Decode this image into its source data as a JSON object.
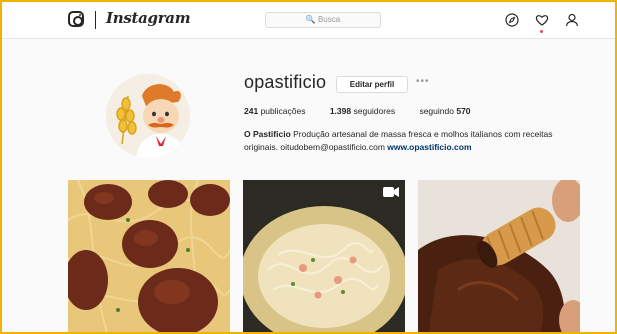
{
  "header": {
    "wordmark": "Instagram",
    "search_placeholder": "🔍 Busca",
    "icons": [
      "instagram-glyph-icon",
      "explore-compass-icon",
      "activity-heart-icon",
      "profile-person-icon"
    ]
  },
  "profile": {
    "username": "opastificio",
    "edit_button": "Editar perfil",
    "more_label": "•••",
    "stats": {
      "posts_count": "241",
      "posts_label": "publicações",
      "followers_count": "1.398",
      "followers_label": "seguidores",
      "following_label": "seguindo",
      "following_count": "570"
    },
    "bio": {
      "name": "O Pastificio",
      "text_line1": "Produção artesanal de massa fresca e molhos italianos com receitas",
      "text_line2": "originais. oitudobem@opastificio.com",
      "link": "www.opastificio.com"
    }
  },
  "grid": {
    "posts": [
      {
        "subject": "meatballs-pasta-photo"
      },
      {
        "subject": "creamy-pasta-bowl-photo",
        "badge": "video-camera-icon"
      },
      {
        "subject": "cannoli-chocolate-photo"
      }
    ]
  },
  "colors": {
    "frame_border": "#f0b400",
    "link": "#003569",
    "notification_dot": "#ed4956"
  }
}
